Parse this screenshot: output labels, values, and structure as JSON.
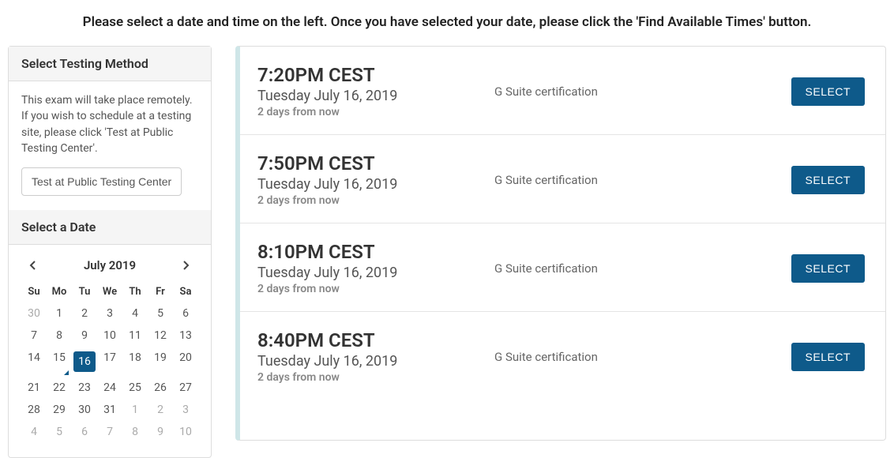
{
  "instruction": "Please select a date and time on the left. Once you have selected your date, please click the 'Find Available Times' button.",
  "sidebar": {
    "method_header": "Select Testing Method",
    "method_description": "This exam will take place remotely. If you wish to schedule at a testing site, please click 'Test at Public Testing Center'.",
    "public_center_button": "Test at Public Testing Center",
    "date_header": "Select a Date",
    "calendar": {
      "month_label": "July 2019",
      "dow": [
        "Su",
        "Mo",
        "Tu",
        "We",
        "Th",
        "Fr",
        "Sa"
      ],
      "days": [
        {
          "n": 30,
          "muted": true
        },
        {
          "n": 1
        },
        {
          "n": 2
        },
        {
          "n": 3
        },
        {
          "n": 4
        },
        {
          "n": 5
        },
        {
          "n": 6
        },
        {
          "n": 7
        },
        {
          "n": 8
        },
        {
          "n": 9
        },
        {
          "n": 10
        },
        {
          "n": 11
        },
        {
          "n": 12
        },
        {
          "n": 13
        },
        {
          "n": 14
        },
        {
          "n": 15,
          "today": true
        },
        {
          "n": 16,
          "selected": true
        },
        {
          "n": 17
        },
        {
          "n": 18
        },
        {
          "n": 19
        },
        {
          "n": 20
        },
        {
          "n": 21
        },
        {
          "n": 22
        },
        {
          "n": 23
        },
        {
          "n": 24
        },
        {
          "n": 25
        },
        {
          "n": 26
        },
        {
          "n": 27
        },
        {
          "n": 28
        },
        {
          "n": 29
        },
        {
          "n": 30
        },
        {
          "n": 31
        },
        {
          "n": 1,
          "muted": true
        },
        {
          "n": 2,
          "muted": true
        },
        {
          "n": 3,
          "muted": true
        },
        {
          "n": 4,
          "muted": true
        },
        {
          "n": 5,
          "muted": true
        },
        {
          "n": 6,
          "muted": true
        },
        {
          "n": 7,
          "muted": true
        },
        {
          "n": 8,
          "muted": true
        },
        {
          "n": 9,
          "muted": true
        },
        {
          "n": 10,
          "muted": true
        }
      ]
    }
  },
  "slots": [
    {
      "time": "7:20PM CEST",
      "date": "Tuesday July 16, 2019",
      "rel": "2 days from now",
      "desc": "G Suite certification",
      "button": "SELECT"
    },
    {
      "time": "7:50PM CEST",
      "date": "Tuesday July 16, 2019",
      "rel": "2 days from now",
      "desc": "G Suite certification",
      "button": "SELECT"
    },
    {
      "time": "8:10PM CEST",
      "date": "Tuesday July 16, 2019",
      "rel": "2 days from now",
      "desc": "G Suite certification",
      "button": "SELECT"
    },
    {
      "time": "8:40PM CEST",
      "date": "Tuesday July 16, 2019",
      "rel": "2 days from now",
      "desc": "G Suite certification",
      "button": "SELECT"
    }
  ]
}
